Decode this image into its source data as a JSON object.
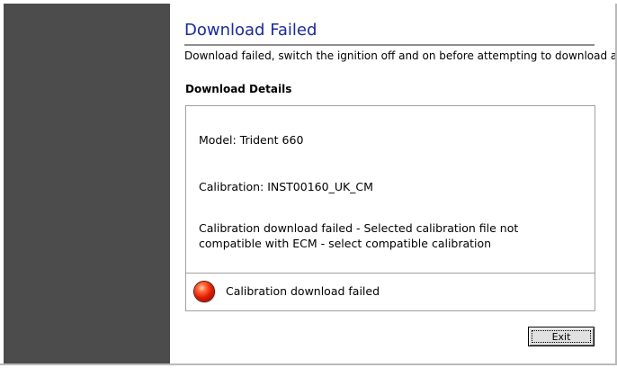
{
  "dialog": {
    "title": "Download Failed",
    "subtitle": "Download failed, switch the ignition off and on before attempting to download again",
    "details_heading": "Download Details"
  },
  "details": {
    "model": "Model: Trident 660",
    "calibration": "Calibration: INST00160_UK_CM",
    "message": "Calibration download failed - Selected calibration file not compatible with ECM - select compatible calibration"
  },
  "status": {
    "icon": "red-status-light-icon",
    "text": "Calibration download failed",
    "color": "#e01a00"
  },
  "buttons": {
    "exit_label": "Exit"
  },
  "colors": {
    "sidebar": "#4c4c4c",
    "title": "#1a2a9c"
  }
}
